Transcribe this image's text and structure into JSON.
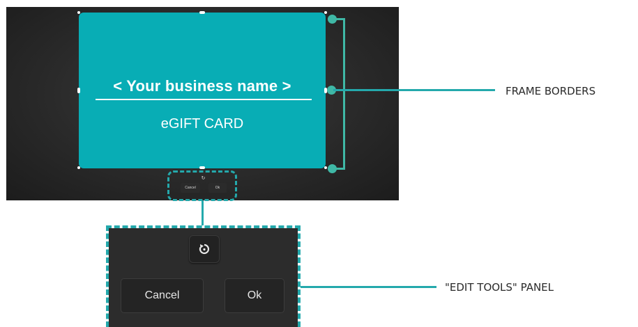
{
  "card": {
    "title": "< Your business name >",
    "subtitle": "eGIFT CARD",
    "color": "#08adb5"
  },
  "edit_tools": {
    "rotate_icon": "rotate-icon",
    "cancel_label": "Cancel",
    "ok_label": "Ok"
  },
  "callouts": {
    "frame_borders": "FRAME BORDERS",
    "edit_tools_panel": "\"EDIT TOOLS\" PANEL"
  },
  "colors": {
    "accent": "#24a9ac",
    "bracket": "#3fb8a6",
    "panel_bg": "#2c2c2c"
  }
}
